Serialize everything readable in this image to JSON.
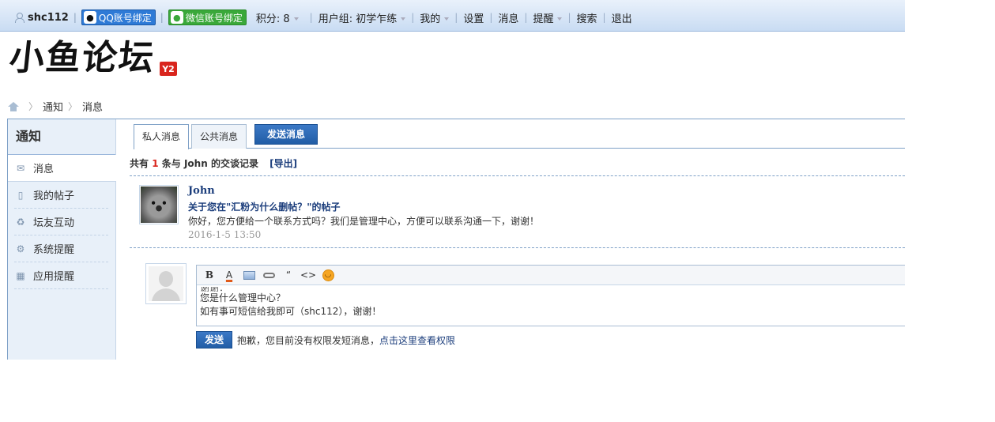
{
  "topbar": {
    "username": "shc112",
    "qq_bind": "QQ账号绑定",
    "wechat_bind": "微信账号绑定",
    "points": "积分: 8",
    "usergroup": "用户组: 初学乍练",
    "links": [
      "我的",
      "设置",
      "消息",
      "提醒",
      "搜索",
      "退出"
    ]
  },
  "logo": {
    "text": "小鱼论坛",
    "badge": "Y2"
  },
  "breadcrumb": [
    "通知",
    "消息"
  ],
  "sidebar": {
    "title": "通知",
    "items": [
      {
        "label": "消息",
        "icon": "envelope-icon"
      },
      {
        "label": "我的帖子",
        "icon": "document-icon"
      },
      {
        "label": "坛友互动",
        "icon": "recycle-icon"
      },
      {
        "label": "系统提醒",
        "icon": "gear-icon"
      },
      {
        "label": "应用提醒",
        "icon": "grid-icon"
      }
    ]
  },
  "tabs": {
    "private": "私人消息",
    "public": "公共消息",
    "send": "发送消息"
  },
  "summary": {
    "prefix": "共有",
    "count": "1",
    "mid": "条与",
    "user": "John",
    "suffix": "的交谈记录",
    "export": "[导出]"
  },
  "message": {
    "author": "John",
    "subject": "关于您在\"汇粉为什么删帖？\"的帖子",
    "body": "你好，您方便给一个联系方式吗？我们是管理中心，方便可以联系沟通一下，谢谢！",
    "time": "2016-1-5 13:50"
  },
  "editor": {
    "line0": "谢谢：",
    "line1": "您是什么管理中心？",
    "line2": "如有事可短信给我即可（shc112），谢谢！"
  },
  "reply": {
    "send": "发送",
    "note": "抱歉，您目前没有权限发短消息，",
    "link": "点击这里查看权限"
  }
}
